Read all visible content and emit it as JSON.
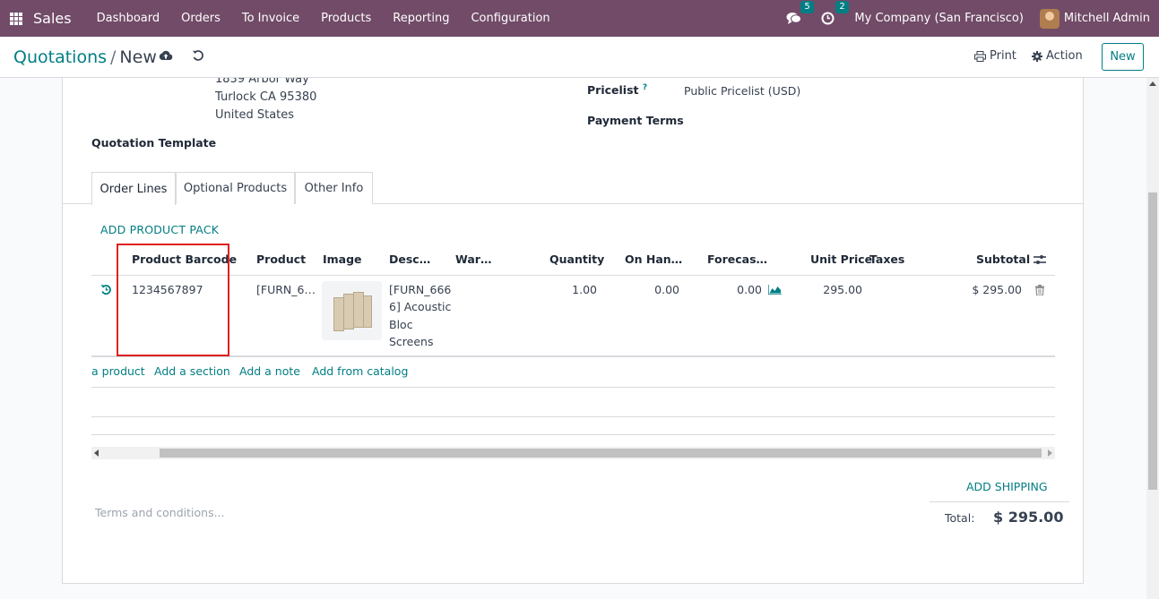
{
  "navbar": {
    "app_name": "Sales",
    "menu": [
      "Dashboard",
      "Orders",
      "To Invoice",
      "Products",
      "Reporting",
      "Configuration"
    ],
    "messages_count": "5",
    "activities_count": "2",
    "company": "My Company (San Francisco)",
    "user": "Mitchell Admin"
  },
  "control_panel": {
    "breadcrumb_parent": "Quotations",
    "breadcrumb_sep": "/",
    "breadcrumb_current": "New",
    "print_label": "Print",
    "action_label": "Action",
    "new_label": "New"
  },
  "customer": {
    "address_line1": "1839 Arbor Way",
    "address_line2": "Turlock CA 95380",
    "address_line3": "United States"
  },
  "fields": {
    "quotation_template_label": "Quotation Template",
    "pricelist_label": "Pricelist",
    "pricelist_help": "?",
    "pricelist_value": "Public Pricelist (USD)",
    "payment_terms_label": "Payment Terms"
  },
  "tabs": [
    "Order Lines",
    "Optional Products",
    "Other Info"
  ],
  "order_lines": {
    "add_pack_label": "ADD PRODUCT PACK",
    "columns": {
      "barcode": "Product Barcode",
      "product": "Product",
      "image": "Image",
      "description": "Desc…",
      "warehouse": "War…",
      "quantity": "Quantity",
      "on_hand": "On Han…",
      "forecast": "Forecas…",
      "unit_price": "Unit Price",
      "taxes": "Taxes",
      "subtotal": "Subtotal"
    },
    "row": {
      "barcode": "1234567897",
      "product": "[FURN_6…",
      "description_1": "[FURN_666",
      "description_2": "6] Acoustic",
      "description_3": "Bloc",
      "description_4": "Screens",
      "quantity": "1.00",
      "on_hand": "0.00",
      "forecast": "0.00",
      "unit_price": "295.00",
      "subtotal": "$ 295.00"
    },
    "add_product": "a product",
    "add_section": "Add a section",
    "add_note": "Add a note",
    "add_catalog": "Add from catalog"
  },
  "footer": {
    "terms_placeholder": "Terms and conditions...",
    "add_shipping": "ADD SHIPPING",
    "total_label": "Total:",
    "total_value": "$ 295.00"
  }
}
